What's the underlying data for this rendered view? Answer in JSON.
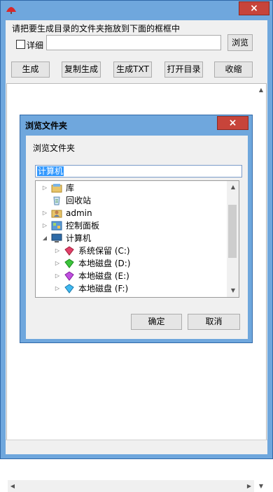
{
  "main": {
    "instruction": "请把要生成目录的文件夹拖放到下面的框框中",
    "detail_label": "详细",
    "path_value": "",
    "browse_label": "浏览",
    "buttons": [
      "生成",
      "复制生成",
      "生成TXT",
      "打开目录",
      "收缩"
    ],
    "close_glyph": "×"
  },
  "dialog": {
    "title": "浏览文件夹",
    "description": "浏览文件夹",
    "selected": "计算机",
    "ok_label": "确定",
    "cancel_label": "取消",
    "close_glyph": "×",
    "tree": [
      {
        "label": "库",
        "icon": "library-icon",
        "expander": "collapsed"
      },
      {
        "label": "回收站",
        "icon": "recycle-bin-icon",
        "expander": "none"
      },
      {
        "label": "admin",
        "icon": "user-folder-icon",
        "expander": "collapsed"
      },
      {
        "label": "控制面板",
        "icon": "control-panel-icon",
        "expander": "collapsed"
      },
      {
        "label": "计算机",
        "icon": "computer-icon",
        "expander": "expanded"
      },
      {
        "label": "系统保留 (C:)",
        "icon": "drive-icon",
        "expander": "collapsed"
      },
      {
        "label": "本地磁盘 (D:)",
        "icon": "drive-icon",
        "expander": "collapsed"
      },
      {
        "label": "本地磁盘 (E:)",
        "icon": "drive-icon",
        "expander": "collapsed"
      },
      {
        "label": "本地磁盘 (F:)",
        "icon": "drive-icon",
        "expander": "collapsed"
      }
    ]
  },
  "colors": {
    "window_frame": "#6fa7dd",
    "close_red": "#c7443a",
    "selection_blue": "#3399ff"
  }
}
